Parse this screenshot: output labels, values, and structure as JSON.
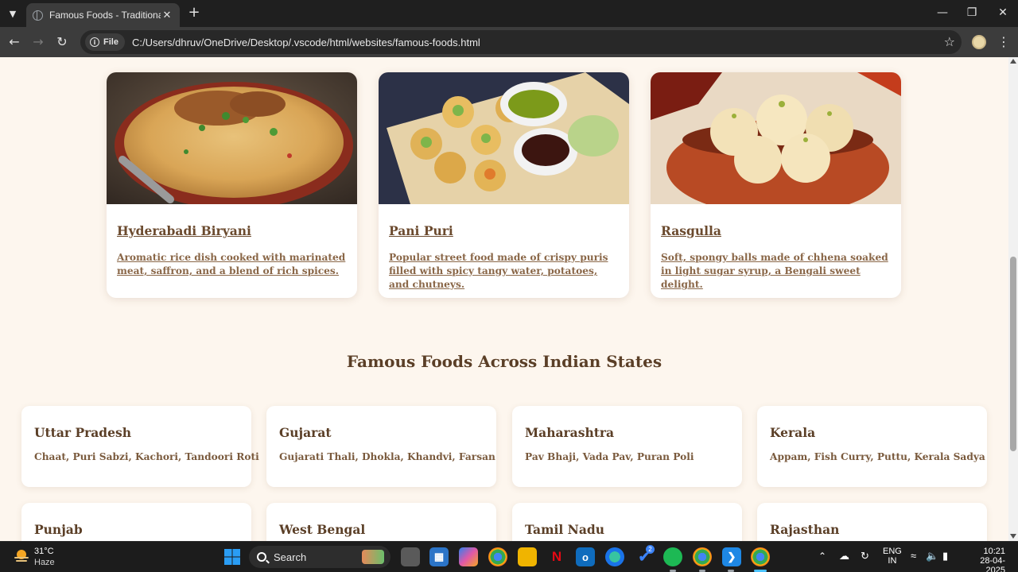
{
  "browser": {
    "tab_title": "Famous Foods - Traditional Trai",
    "chip_label": "File",
    "url": "C:/Users/dhruv/OneDrive/Desktop/.vscode/html/websites/famous-foods.html"
  },
  "page": {
    "dishes": [
      {
        "name": "Hyderabadi Biryani",
        "description": "Aromatic rice dish cooked with marinated meat, saffron, and a blend of rich spices."
      },
      {
        "name": "Pani Puri",
        "description": "Popular street food made of crispy puris filled with spicy tangy water, potatoes, and chutneys."
      },
      {
        "name": "Rasgulla",
        "description": "Soft, spongy balls made of chhena soaked in light sugar syrup, a Bengali sweet delight."
      }
    ],
    "section_title": "Famous Foods Across Indian States",
    "states": [
      {
        "name": "Uttar Pradesh",
        "foods": "Chaat, Puri Sabzi, Kachori, Tandoori Roti"
      },
      {
        "name": "Gujarat",
        "foods": "Gujarati Thali, Dhokla, Khandvi, Farsan"
      },
      {
        "name": "Maharashtra",
        "foods": "Pav Bhaji, Vada Pav, Puran Poli"
      },
      {
        "name": "Kerala",
        "foods": "Appam, Fish Curry, Puttu, Kerala Sadya"
      },
      {
        "name": "Punjab",
        "foods": ""
      },
      {
        "name": "West Bengal",
        "foods": ""
      },
      {
        "name": "Tamil Nadu",
        "foods": ""
      },
      {
        "name": "Rajasthan",
        "foods": ""
      }
    ]
  },
  "taskbar": {
    "weather_temp": "31°C",
    "weather_desc": "Haze",
    "search_label": "Search",
    "lang_line1": "ENG",
    "lang_line2": "IN",
    "time": "10:21",
    "date": "28-04-2025",
    "todo_badge": "2"
  },
  "colors": {
    "page_bg": "#fdf6ee",
    "heading": "#5b3f27",
    "link": "#6b4a2e"
  }
}
